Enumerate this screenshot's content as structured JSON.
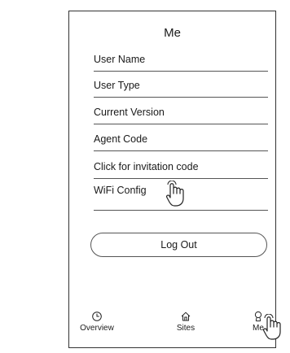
{
  "page": {
    "title": "Me"
  },
  "menu": {
    "items": [
      {
        "label": "User Name"
      },
      {
        "label": "User Type"
      },
      {
        "label": "Current Version"
      },
      {
        "label": "Agent Code"
      },
      {
        "label": "Click for invitation code"
      },
      {
        "label": "WiFi Config"
      }
    ]
  },
  "actions": {
    "logout_label": "Log Out"
  },
  "bottom_nav": {
    "items": [
      {
        "label": "Overview",
        "icon": "clock-icon"
      },
      {
        "label": "Sites",
        "icon": "home-icon"
      },
      {
        "label": "Me",
        "icon": "person-icon"
      }
    ],
    "active": "Me"
  }
}
